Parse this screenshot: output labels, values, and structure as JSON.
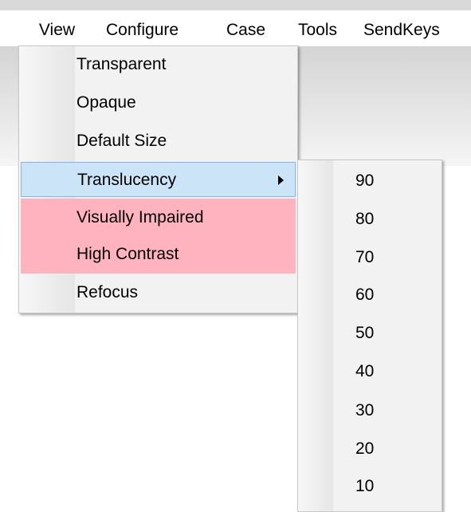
{
  "menubar": {
    "items": [
      {
        "label": "View"
      },
      {
        "label": "Configure"
      },
      {
        "label": "Case"
      },
      {
        "label": "Tools"
      },
      {
        "label": "SendKeys"
      }
    ]
  },
  "view_menu": {
    "items": [
      {
        "label": "Transparent"
      },
      {
        "label": "Opaque"
      },
      {
        "label": "Default Size"
      },
      {
        "label": "Translucency"
      },
      {
        "label": "Visually Impaired"
      },
      {
        "label": "High Contrast"
      },
      {
        "label": "Refocus"
      }
    ],
    "highlight_color": "#cce4f7",
    "accent_color": "#ffb3bf"
  },
  "translucency_submenu": {
    "items": [
      "90",
      "80",
      "70",
      "60",
      "50",
      "40",
      "30",
      "20",
      "10"
    ]
  }
}
